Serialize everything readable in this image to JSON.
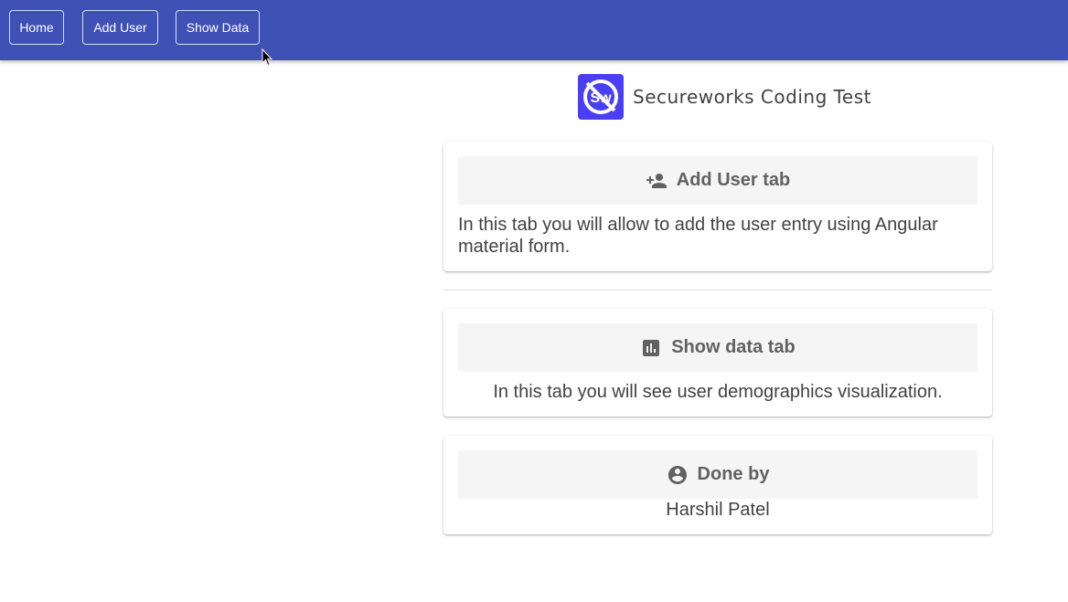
{
  "nav": {
    "home_label": "Home",
    "add_user_label": "Add User",
    "show_data_label": "Show Data"
  },
  "brand": {
    "logo_text": "Sw",
    "title": "Secureworks Coding Test"
  },
  "cards": [
    {
      "icon": "person-add-icon",
      "title": "Add User tab",
      "body": "In this tab you will allow to add the user entry using Angular material form."
    },
    {
      "icon": "bar-chart-icon",
      "title": "Show data tab",
      "body": "In this tab you will see user demographics visualization."
    },
    {
      "icon": "account-circle-icon",
      "title": "Done by",
      "body": "Harshil Patel"
    }
  ],
  "colors": {
    "toolbar": "#3f51b5",
    "logo": "#4a3ff5",
    "header_bg": "#f5f5f5"
  }
}
